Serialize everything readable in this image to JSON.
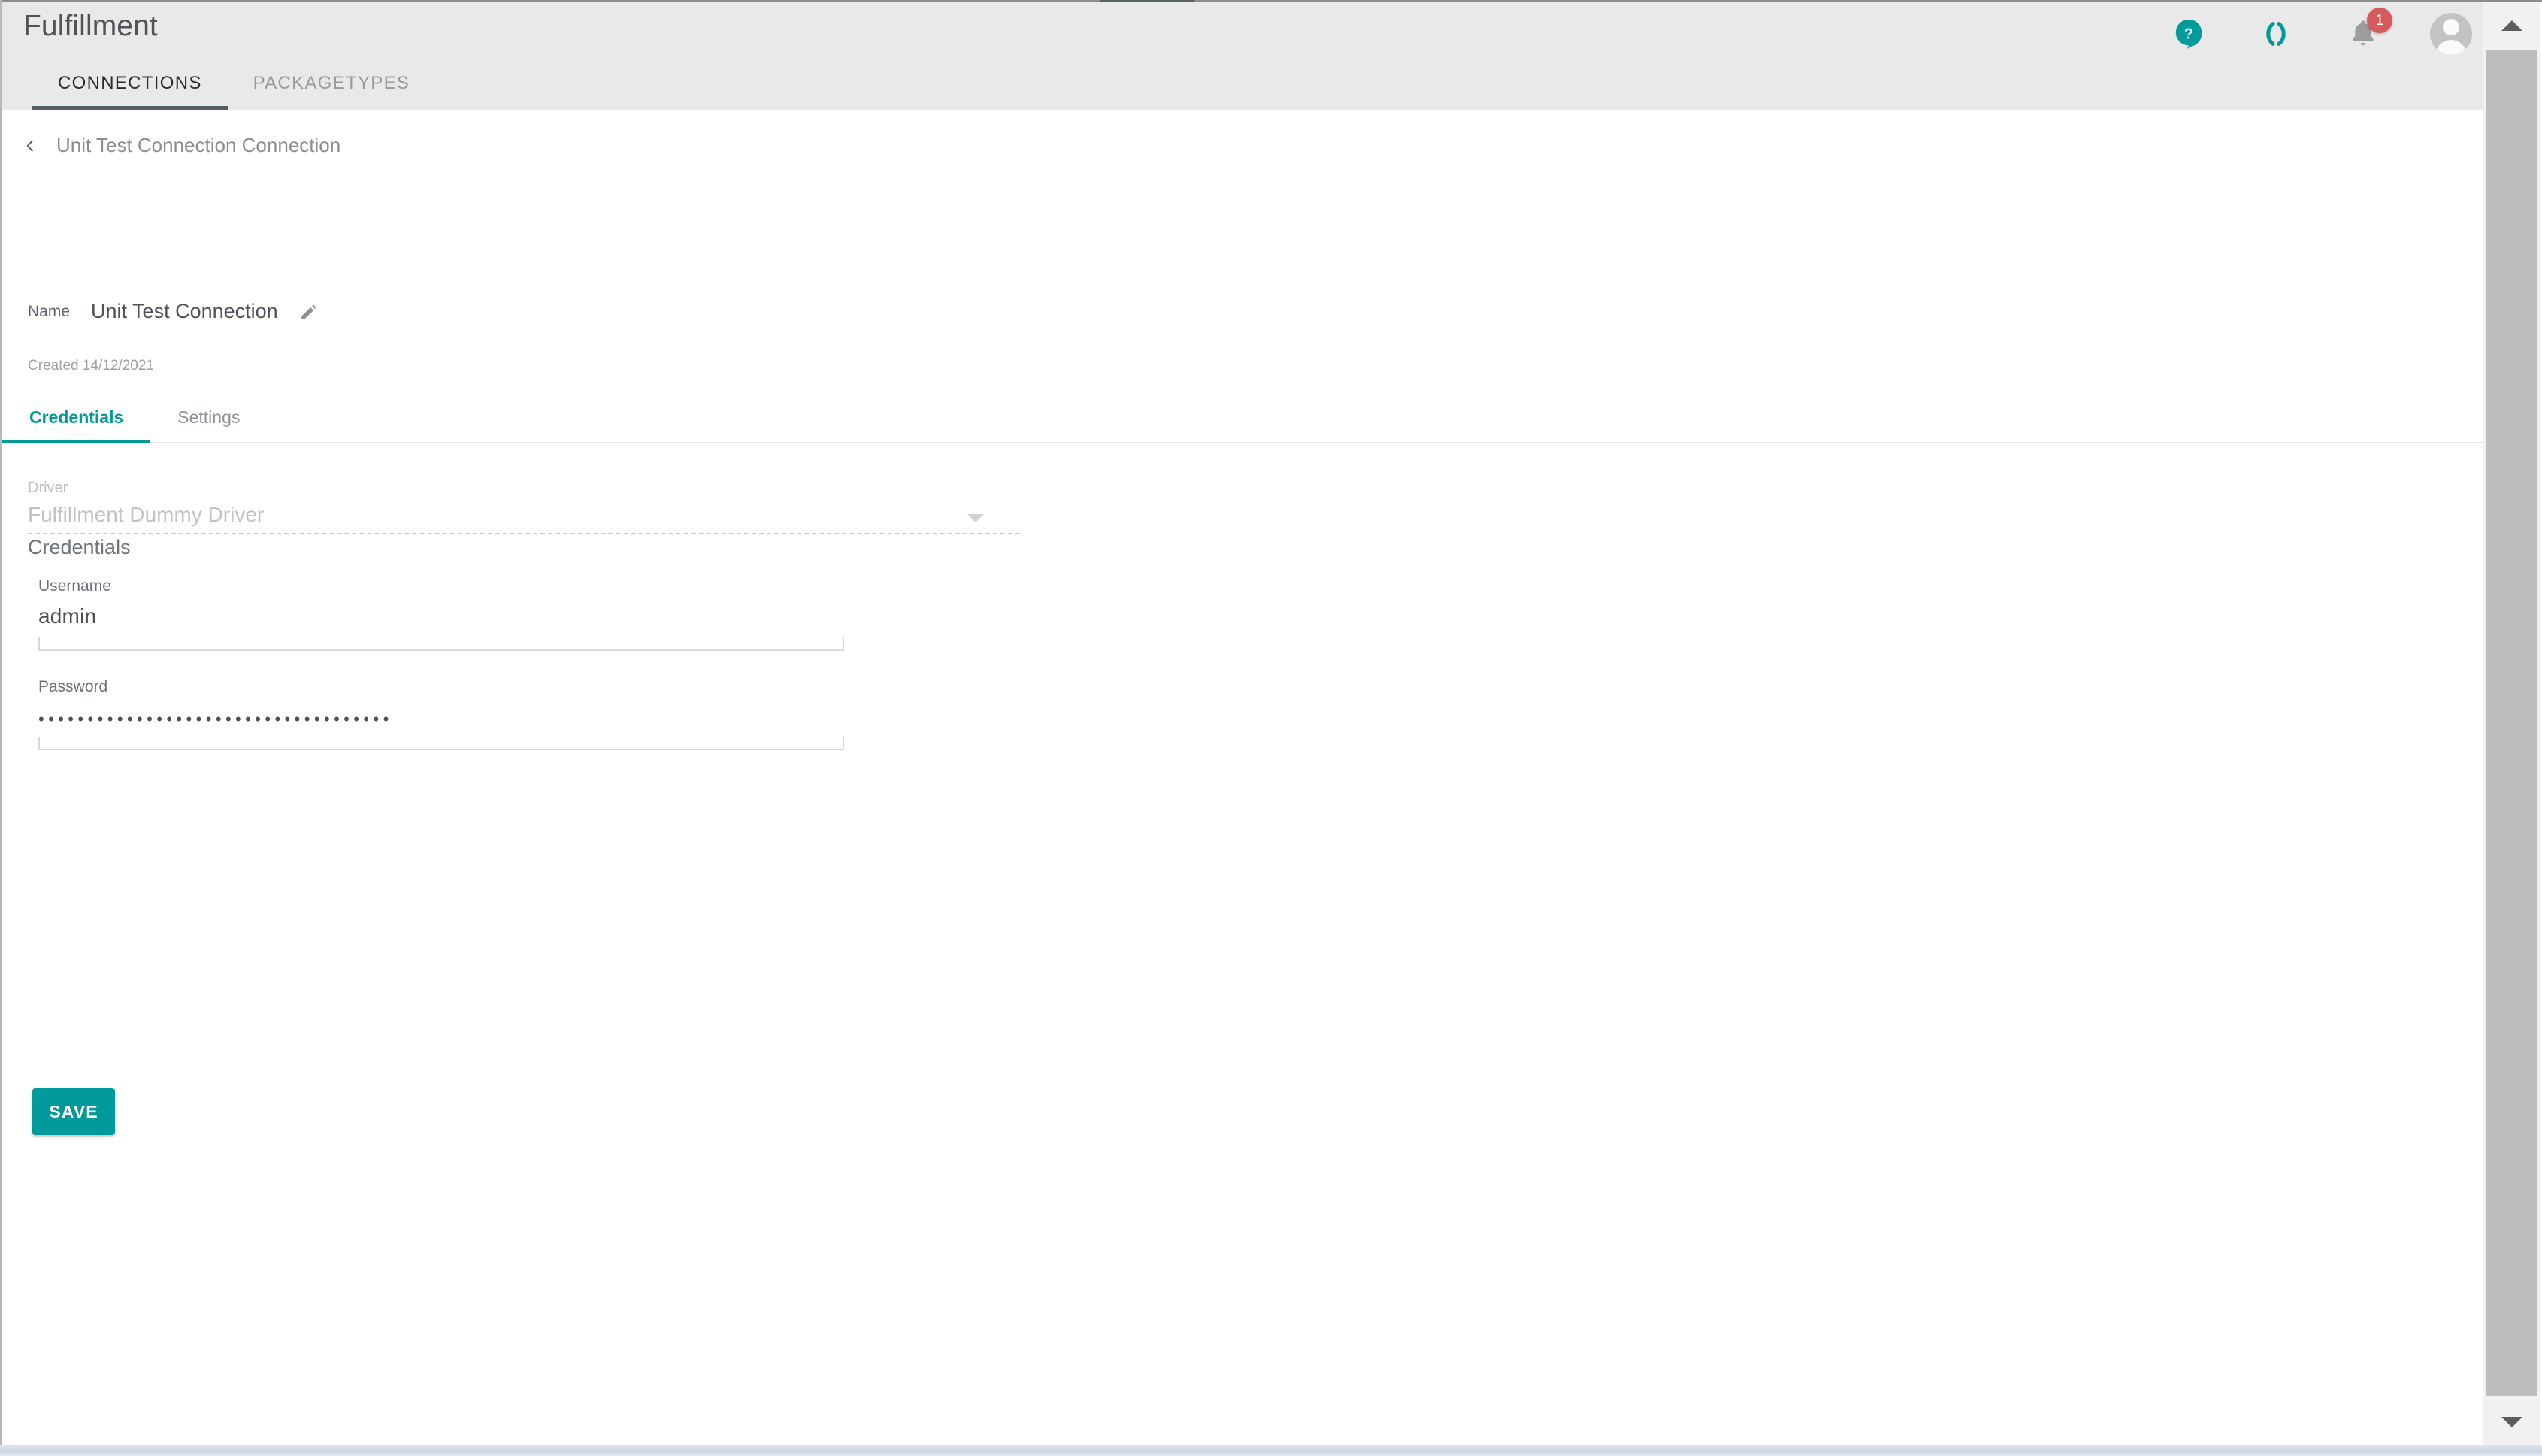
{
  "app": {
    "title": "Fulfillment",
    "hamburger_tab": "menu-tab"
  },
  "header": {
    "icons": {
      "help": "help-icon",
      "loading": "loading-parentheses-icon",
      "notifications": "bell-icon",
      "avatar": "user-avatar"
    },
    "notification_count": "1"
  },
  "module_tabs": [
    {
      "label": "CONNECTIONS",
      "active": true
    },
    {
      "label": "PACKAGETYPES",
      "active": false
    }
  ],
  "breadcrumb": {
    "back_icon": "chevron-left-icon",
    "title": "Unit Test Connection Connection"
  },
  "name_row": {
    "label": "Name",
    "value": "Unit Test Connection",
    "edit_icon": "pencil-icon"
  },
  "created": "Created 14/12/2021",
  "inner_tabs": [
    {
      "label": "Credentials",
      "active": true
    },
    {
      "label": "Settings",
      "active": false
    }
  ],
  "form": {
    "driver": {
      "label": "Driver",
      "value": "Fulfillment Dummy Driver",
      "disabled": true,
      "caret_icon": "chevron-down-icon"
    },
    "section_title": "Credentials",
    "username": {
      "label": "Username",
      "value": "admin",
      "placeholder": ""
    },
    "password": {
      "label": "Password",
      "value": "••••••••••••••••••••••••••••••••••••",
      "placeholder": ""
    },
    "save_label": "SAVE"
  },
  "scrollbar": {
    "up_icon": "scroll-up-arrow-icon",
    "down_icon": "scroll-down-arrow-icon"
  },
  "colors": {
    "accent_teal": "#009a9a",
    "header_bg": "#e9e9e9",
    "tab_underline": "#556065",
    "badge_red": "#d45b5b",
    "body_text": "#4a5054",
    "muted_text": "#8d8d8d"
  }
}
